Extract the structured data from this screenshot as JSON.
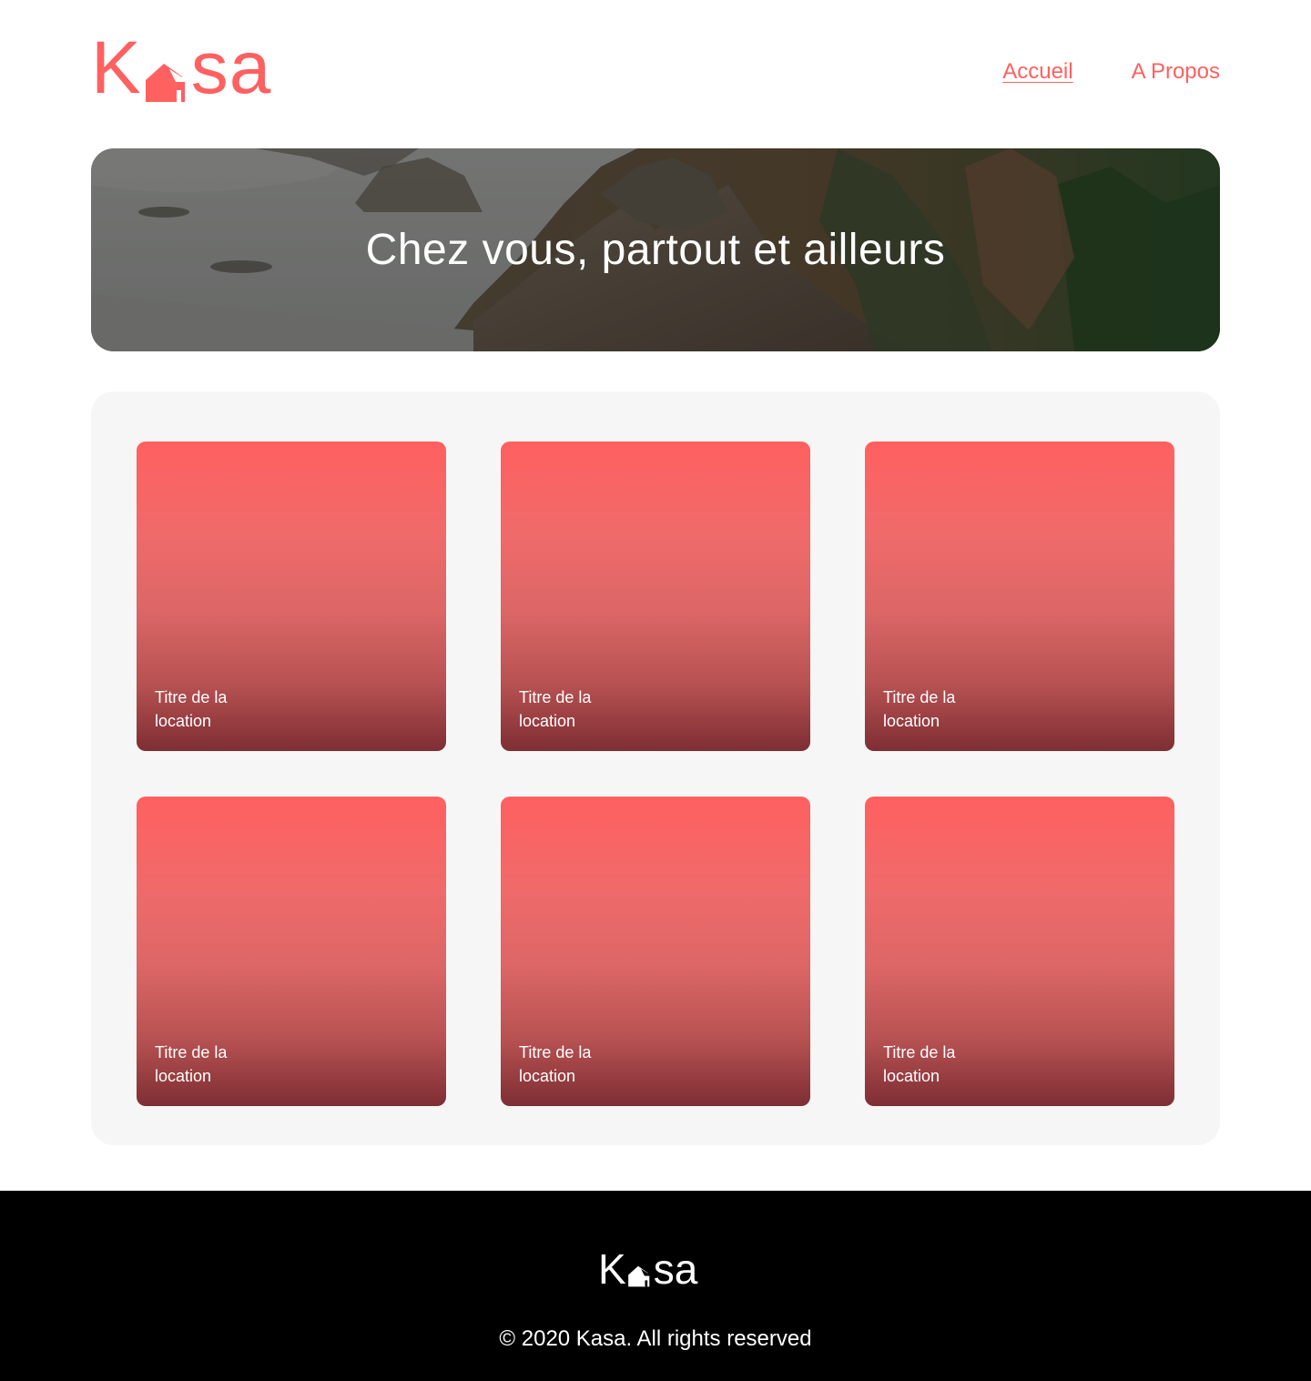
{
  "brand": {
    "logo_k": "K",
    "logo_rest": "sa",
    "color": "#FF6060"
  },
  "nav": {
    "home_label": "Accueil",
    "about_label": "A Propos"
  },
  "banner": {
    "title": "Chez vous, partout et ailleurs"
  },
  "cards": [
    {
      "title": "Titre de la location"
    },
    {
      "title": "Titre de la location"
    },
    {
      "title": "Titre de la location"
    },
    {
      "title": "Titre de la location"
    },
    {
      "title": "Titre de la location"
    },
    {
      "title": "Titre de la location"
    }
  ],
  "footer": {
    "logo_k": "K",
    "logo_rest": "sa",
    "copyright": "© 2020 Kasa. All rights reserved"
  }
}
